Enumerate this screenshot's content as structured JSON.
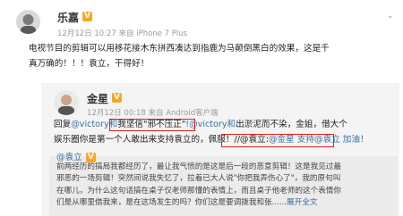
{
  "post": {
    "author": "乐嘉",
    "verified_badge": "V",
    "timestamp": "12月12日 10:27 来自 iPhone 7 Plus",
    "text_line1": "电视节目的剪辑可以用移花接木东拼西凑达到指鹿为马颠倒黑白的效果，这是千",
    "text_line2": "真万确的！！！袁立，干得好！"
  },
  "reply": {
    "author": "金星",
    "verified_badge": "V",
    "timestamp": "12月12日 00:18 来自 Android客户端",
    "reply_prefix": "回复",
    "mention1": "@victory和",
    "boxed_phrase": "我坚信\"邪不压正\"",
    "mention2": "!@victory和",
    "after_phrase": "出淤泥而不染，金姐，借大个",
    "line2": "娱乐圈你是第一个人敢出来支持袁立的，佩服！//@袁立:",
    "boxed2": "@金星 支持@袁立 加油！"
  },
  "quote": {
    "author": "@袁立",
    "verified_badge": "V",
    "line1": "前两经历的搞局我都经历了，最让我气愤的是这是后一段的恶意剪辑！这是我见过最",
    "line2": "邪恶的一场剪辑！突然间说我失忆了，拉着已大人说\"你把我弄伤心了\"，我的原句叫",
    "line3": "在哪儿，为什么这句话搞在桌子仅老师那懂的表情上，而且桌子他老师的这个表情你",
    "line4": "们是从哪里借我来，是在这场发生的吗？你们这是要调拨我和张......",
    "expand": "展开全文"
  },
  "colors": {
    "badge": "#f7a823",
    "box": "#e02020",
    "link": "#3c6ea5"
  },
  "icons": [
    "avatar",
    "chevron-down-icon",
    "verified-icon"
  ]
}
